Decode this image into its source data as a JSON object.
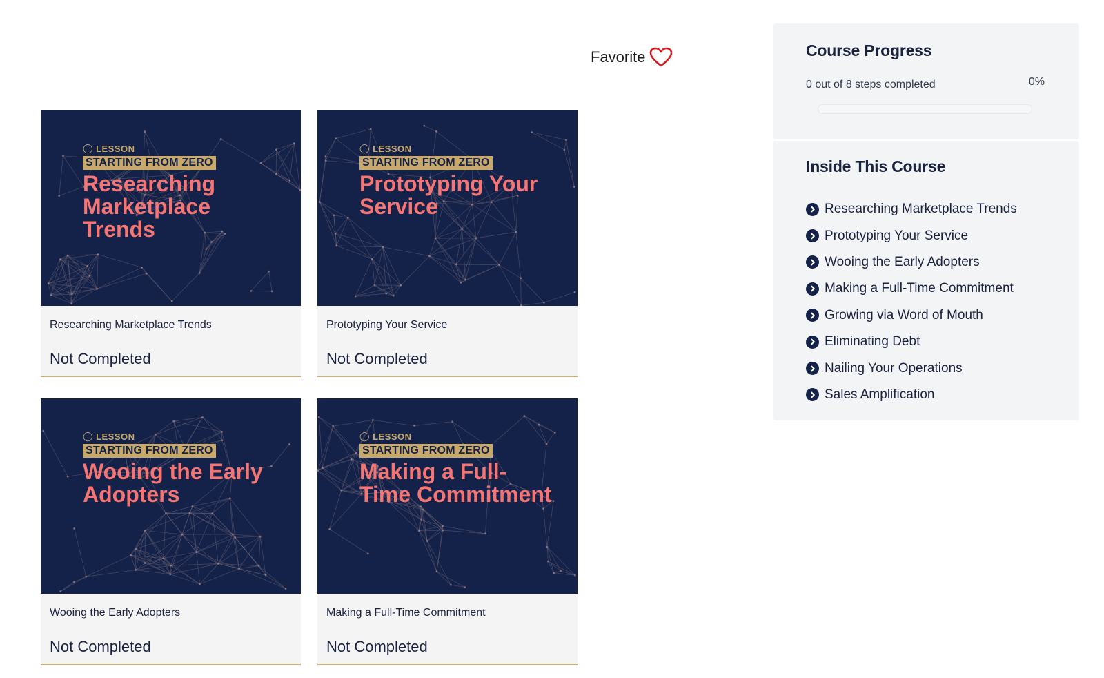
{
  "favorite": {
    "label": "Favorite",
    "icon": "heart-outline-icon",
    "color": "#d6171c"
  },
  "lessons": [
    {
      "thumb_tag": "LESSON",
      "thumb_series": "STARTING FROM ZERO",
      "thumb_title": "Researching Marketplace Trends",
      "title": "Researching Marketplace Trends",
      "status": "Not Completed"
    },
    {
      "thumb_tag": "LESSON",
      "thumb_series": "STARTING FROM ZERO",
      "thumb_title": "Prototyping Your Service",
      "title": "Prototyping Your Service",
      "status": "Not Completed"
    },
    {
      "thumb_tag": "LESSON",
      "thumb_series": "STARTING FROM ZERO",
      "thumb_title": "Wooing the Early Adopters",
      "title": "Wooing the Early Adopters",
      "status": "Not Completed"
    },
    {
      "thumb_tag": "LESSON",
      "thumb_series": "STARTING FROM ZERO",
      "thumb_title": "Making a Full-Time Commitment",
      "title": "Making a Full-Time Commitment",
      "status": "Not Completed"
    }
  ],
  "progress": {
    "heading": "Course Progress",
    "steps_text": "0 out of 8 steps completed",
    "percent_text": "0%",
    "fraction": 0
  },
  "inside": {
    "heading": "Inside This Course",
    "items": [
      "Researching Marketplace Trends",
      "Prototyping Your Service",
      "Wooing the Early Adopters",
      "Making a Full-Time Commitment",
      "Growing via Word of Mouth",
      "Eliminating Debt",
      "Nailing Your Operations",
      "Sales Amplification"
    ]
  },
  "colors": {
    "navy": "#14224a",
    "gold": "#c8a96a",
    "salmon": "#f47573",
    "panel_bg": "#f3f4f6"
  }
}
